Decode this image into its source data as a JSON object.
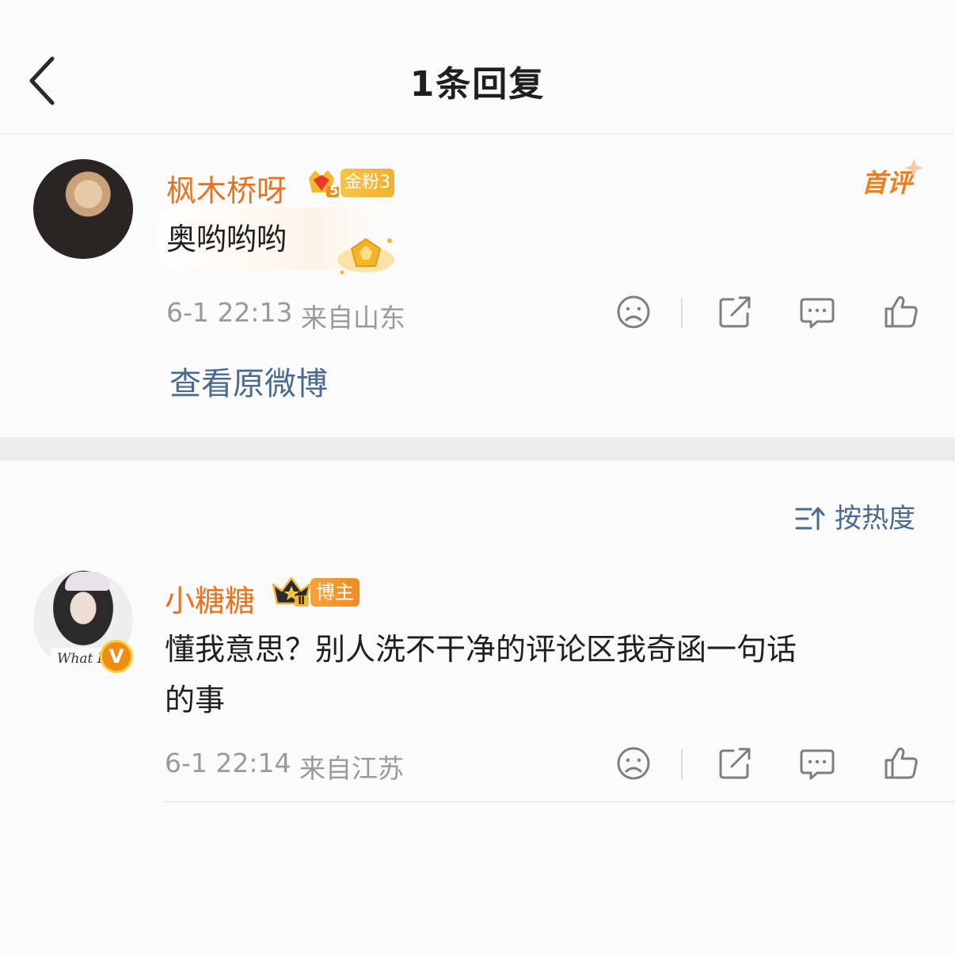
{
  "header": {
    "title": "1条回复"
  },
  "comment": {
    "username": "枫木桥呀",
    "fan_badge_level": "5",
    "fan_badge_label": "金粉3",
    "first_tag": "首评",
    "content": "奥哟哟哟",
    "time": "6-1 22:13",
    "location": "来自山东",
    "view_original": "查看原微博"
  },
  "sort": {
    "label": "按热度"
  },
  "reply": {
    "username": "小糖糖",
    "badge_level": "Ⅱ",
    "badge_label": "博主",
    "verified_mark": "V",
    "avatar_text": "What Do",
    "content_line1": "懂我意思？别人洗不干净的评论区我奇函一句话",
    "content_line2": "的事",
    "time": "6-1 22:14",
    "location": "来自江苏"
  },
  "colors": {
    "name": "#e8731e",
    "link": "#4a6a90",
    "meta": "#9a9a9a",
    "icon": "#7f7f7f"
  }
}
